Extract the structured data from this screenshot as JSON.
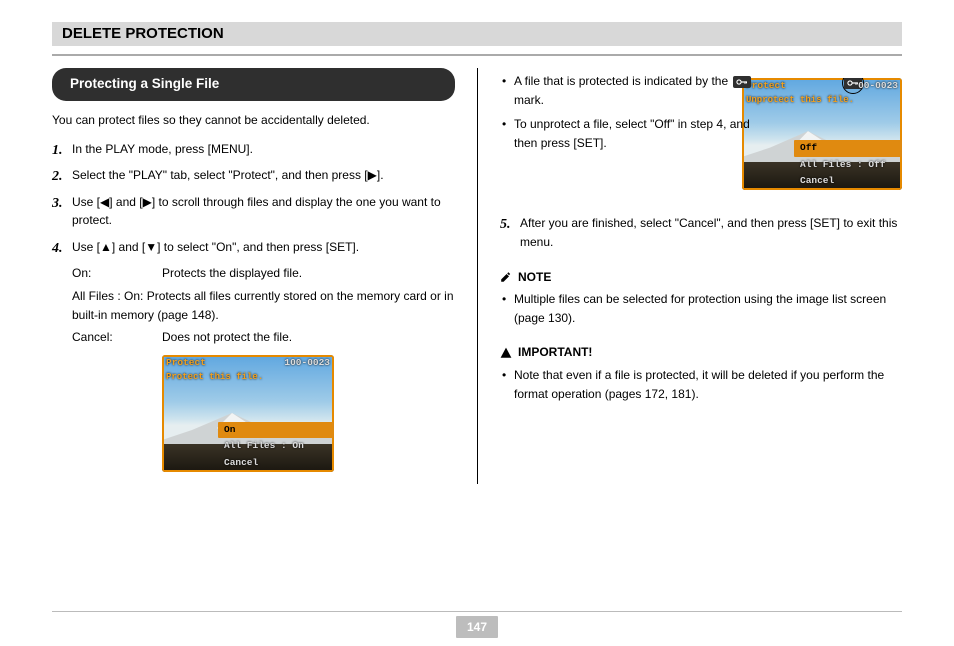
{
  "section_title": "DELETE PROTECTION",
  "page_number": "147",
  "leader": "Protecting a Single File",
  "left": {
    "intro": "You can protect files so they cannot be accidentally deleted.",
    "steps": [
      "In the PLAY mode, press [MENU].",
      "Select the \"PLAY\" tab, select \"Protect\", and then press [▶].",
      "Use [◀] and [▶] to scroll through files and display the one you want to protect.",
      "Use [▲] and [▼] to select \"On\", and then press [SET]."
    ],
    "sub": [
      {
        "label": "On:",
        "text": "Protects the displayed file."
      },
      {
        "label": "All Files : On:",
        "text": "Protects all files currently stored on the memory card or in built-in memory (page 148)."
      },
      {
        "label": "Cancel:",
        "text": "Does not protect the file."
      }
    ],
    "screenshot": {
      "title": "Protect",
      "file_no": "100-0023",
      "subtitle": "Protect this file.",
      "menu": [
        "On",
        "All Files : On",
        "Cancel"
      ],
      "selected_index": 0
    }
  },
  "right": {
    "lead": "A file that is protected is indicated by the        mark.",
    "post": "To unprotect a file, select \"Off\" in step 4, and then press [SET].",
    "step5": "After you are finished, select \"Cancel\", and then press [SET] to exit this menu.",
    "note_label": "NOTE",
    "note_text": "Multiple files can be selected for protection using the image list screen (page 130).",
    "important_label": "IMPORTANT!",
    "important_text": "Note that even if a file is protected, it will be deleted if you perform the format operation (pages 172, 181).",
    "screenshot": {
      "title": "Protect",
      "file_no": "00-0023",
      "subtitle": "Unprotect this file.",
      "menu": [
        "Off",
        "All Files : Off",
        "Cancel"
      ],
      "selected_index": 0
    }
  }
}
